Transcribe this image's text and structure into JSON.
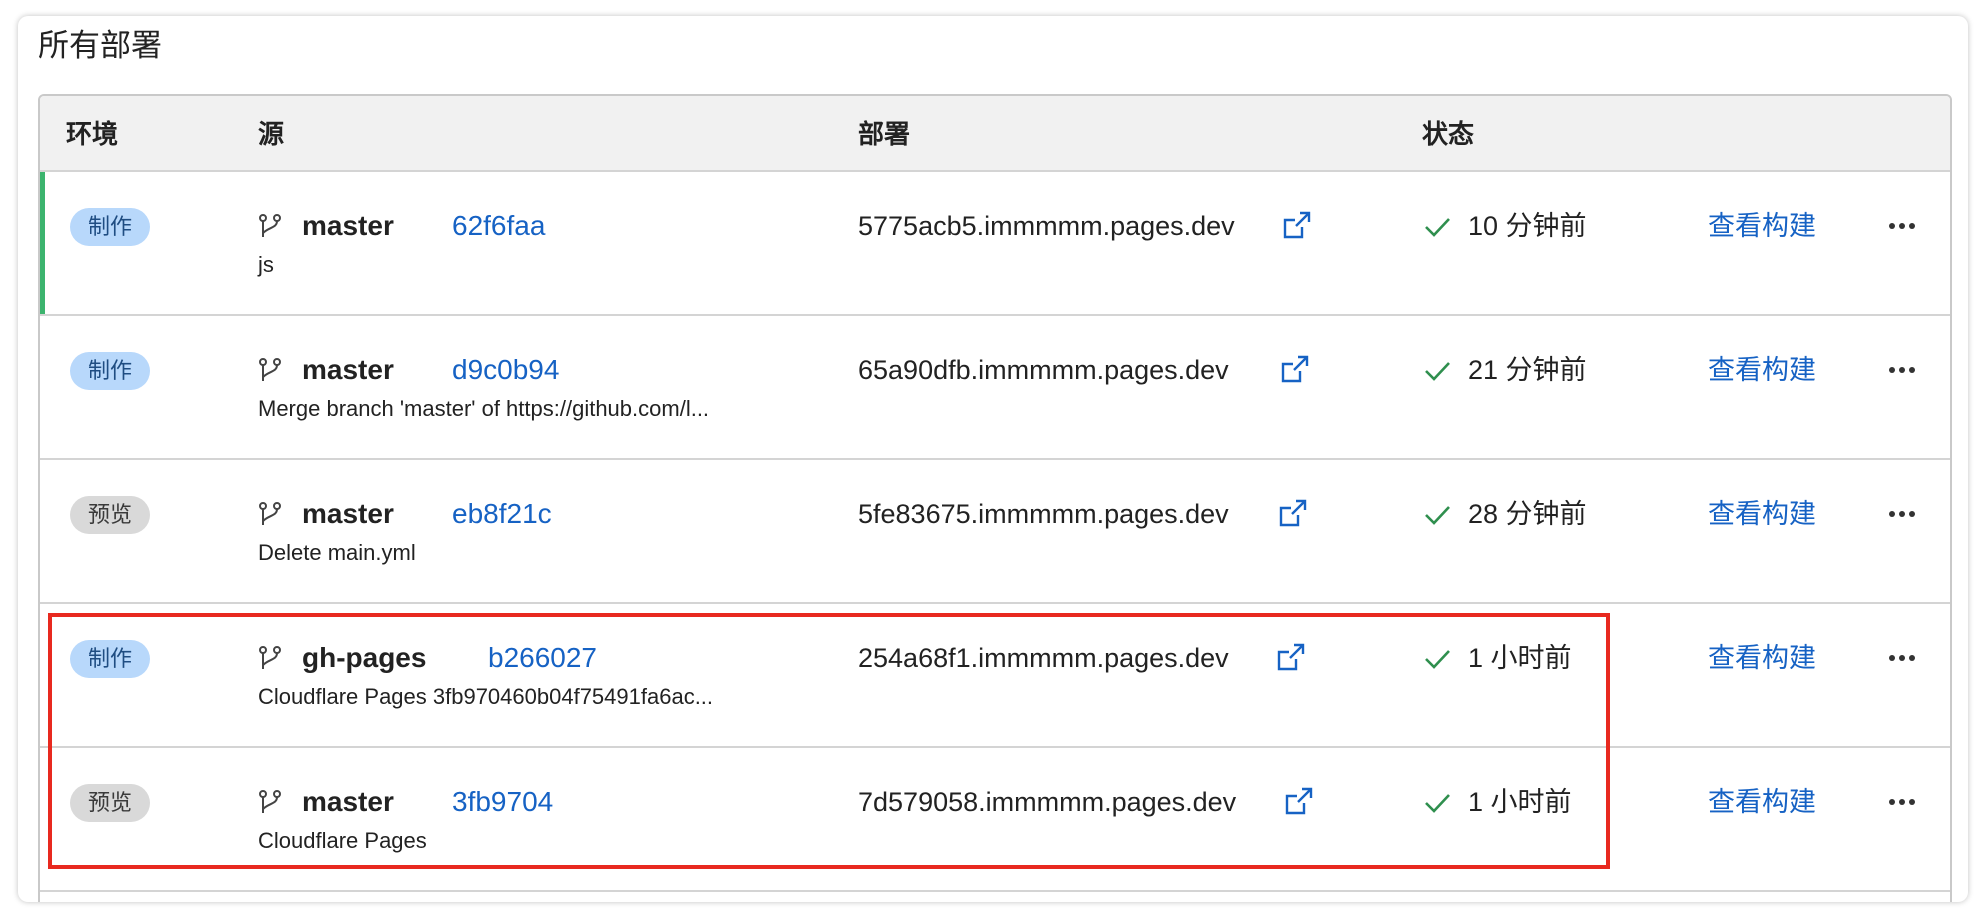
{
  "page": {
    "title": "所有部署"
  },
  "columns": {
    "environment": "环境",
    "source": "源",
    "deployment": "部署",
    "status": "状态"
  },
  "rows": [
    {
      "environment": "制作",
      "environment_type": "production",
      "active": true,
      "branch": "master",
      "commit": "62f6faa",
      "message": "js",
      "url": "5775acb5.immmmm.pages.dev",
      "status": "10 分钟前",
      "action": "查看构建"
    },
    {
      "environment": "制作",
      "environment_type": "production",
      "active": false,
      "branch": "master",
      "commit": "d9c0b94",
      "message": "Merge branch 'master' of https://github.com/l...",
      "url": "65a90dfb.immmmm.pages.dev",
      "status": "21 分钟前",
      "action": "查看构建"
    },
    {
      "environment": "预览",
      "environment_type": "preview",
      "active": false,
      "branch": "master",
      "commit": "eb8f21c",
      "message": "Delete main.yml",
      "url": "5fe83675.immmmm.pages.dev",
      "status": "28 分钟前",
      "action": "查看构建"
    },
    {
      "environment": "制作",
      "environment_type": "production",
      "active": false,
      "branch": "gh-pages",
      "commit": "b266027",
      "message": "Cloudflare Pages 3fb970460b04f75491fa6ac...",
      "url": "254a68f1.immmmm.pages.dev",
      "status": "1 小时前",
      "action": "查看构建"
    },
    {
      "environment": "预览",
      "environment_type": "preview",
      "active": false,
      "branch": "master",
      "commit": "3fb9704",
      "message": "Cloudflare Pages",
      "url": "7d579058.immmmm.pages.dev",
      "status": "1 小时前",
      "action": "查看构建"
    }
  ],
  "icons": {
    "branch": "git-branch-icon",
    "external": "external-link-icon",
    "status": "check-icon",
    "more": "more-horizontal-icon"
  },
  "colors": {
    "link": "#1662c4",
    "success": "#2f8f4e",
    "active_bar": "#3cb46e",
    "production_badge": "#b8d8fb",
    "preview_badge": "#d9d9d9",
    "highlight": "#e8291f"
  }
}
